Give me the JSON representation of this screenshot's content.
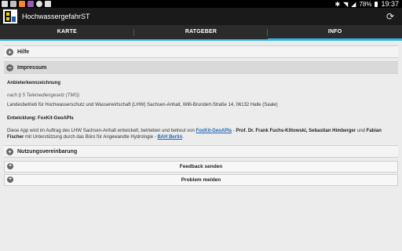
{
  "status_bar": {
    "notification_icons": [
      "screenshot-icon",
      "image-icon",
      "app-icon-orange",
      "app-icon-purple",
      "hangouts-icon",
      "checkbox-icon"
    ],
    "battery": "78%",
    "time": "19:37"
  },
  "app": {
    "title": "HochwassergefahrST",
    "refresh_icon": "refresh-icon"
  },
  "tabs": [
    {
      "label": "KARTE",
      "active": false
    },
    {
      "label": "RATGEBER",
      "active": false
    },
    {
      "label": "INFO",
      "active": true
    }
  ],
  "sections": {
    "hilfe": {
      "label": "Hilfe",
      "icon": "plus-circle-icon",
      "expanded": false
    },
    "impressum": {
      "label": "Impressum",
      "icon": "minus-circle-icon",
      "expanded": true,
      "heading": "Anbieterkennzeichnung",
      "law": "nach § 5 Telemediengesetz (TMG)",
      "provider": "Landesbetrieb für Hochwasserschutz und Wasserwirtschaft (LHW) Sachsen-Anhalt, Willi-Brundert-Straße 14, 06132 Halle (Saale)",
      "dev_heading": "Entwicklung: FoxKit-GeoAPIs",
      "dev_text_1": "Diese App wird im Auftrag des LHW Sachsen-Anhalt entwickelt, betrieben und betreut von ",
      "dev_link_1": "FoxKit-GeoAPIs",
      "dev_text_2": " - ",
      "dev_names_1": "Prof. Dr. Frank Fuchs-Kittowski, Sebastian Himberger",
      "dev_text_3": " und ",
      "dev_names_2": "Fabian Fischer",
      "dev_text_4": " mit Unterstützung durch das Büro für Angewandte Hydrologie - ",
      "dev_link_2": "BAH Berlin",
      "dev_text_5": "."
    },
    "nutzung": {
      "label": "Nutzungsvereinbarung",
      "icon": "plus-circle-icon",
      "expanded": false
    }
  },
  "buttons": {
    "feedback": {
      "label": "Feedback senden",
      "icon": "plus-circle-icon"
    },
    "problem": {
      "label": "Problem melden",
      "icon": "plus-circle-icon"
    }
  }
}
